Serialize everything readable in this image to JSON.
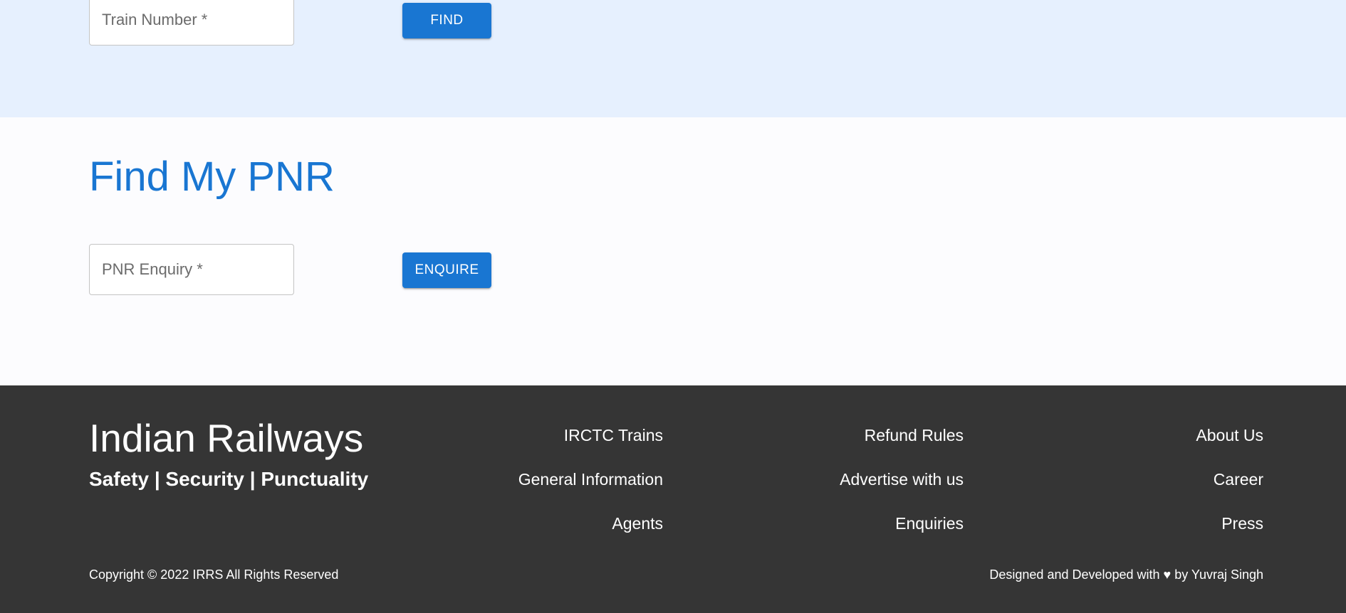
{
  "train_search": {
    "train_number_placeholder": "Train Number *",
    "find_label": "FIND"
  },
  "pnr": {
    "title": "Find My PNR",
    "pnr_placeholder": "PNR Enquiry *",
    "enquire_label": "ENQUIRE"
  },
  "footer": {
    "brand": "Indian Railways",
    "tagline": "Safety | Security | Punctuality",
    "columns": [
      [
        "IRCTC Trains",
        "General Information",
        "Agents"
      ],
      [
        "Refund Rules",
        "Advertise with us",
        "Enquiries"
      ],
      [
        "About Us",
        "Career",
        "Press"
      ]
    ],
    "copyright": "Copyright © 2022 IRRS All Rights Reserved",
    "credits": "Designed and Developed with ♥ by Yuvraj Singh"
  },
  "colors": {
    "primary": "#1976d2",
    "train_section_bg": "#e6f0fe",
    "page_bg": "#fcfcfe",
    "footer_bg": "#353535"
  }
}
